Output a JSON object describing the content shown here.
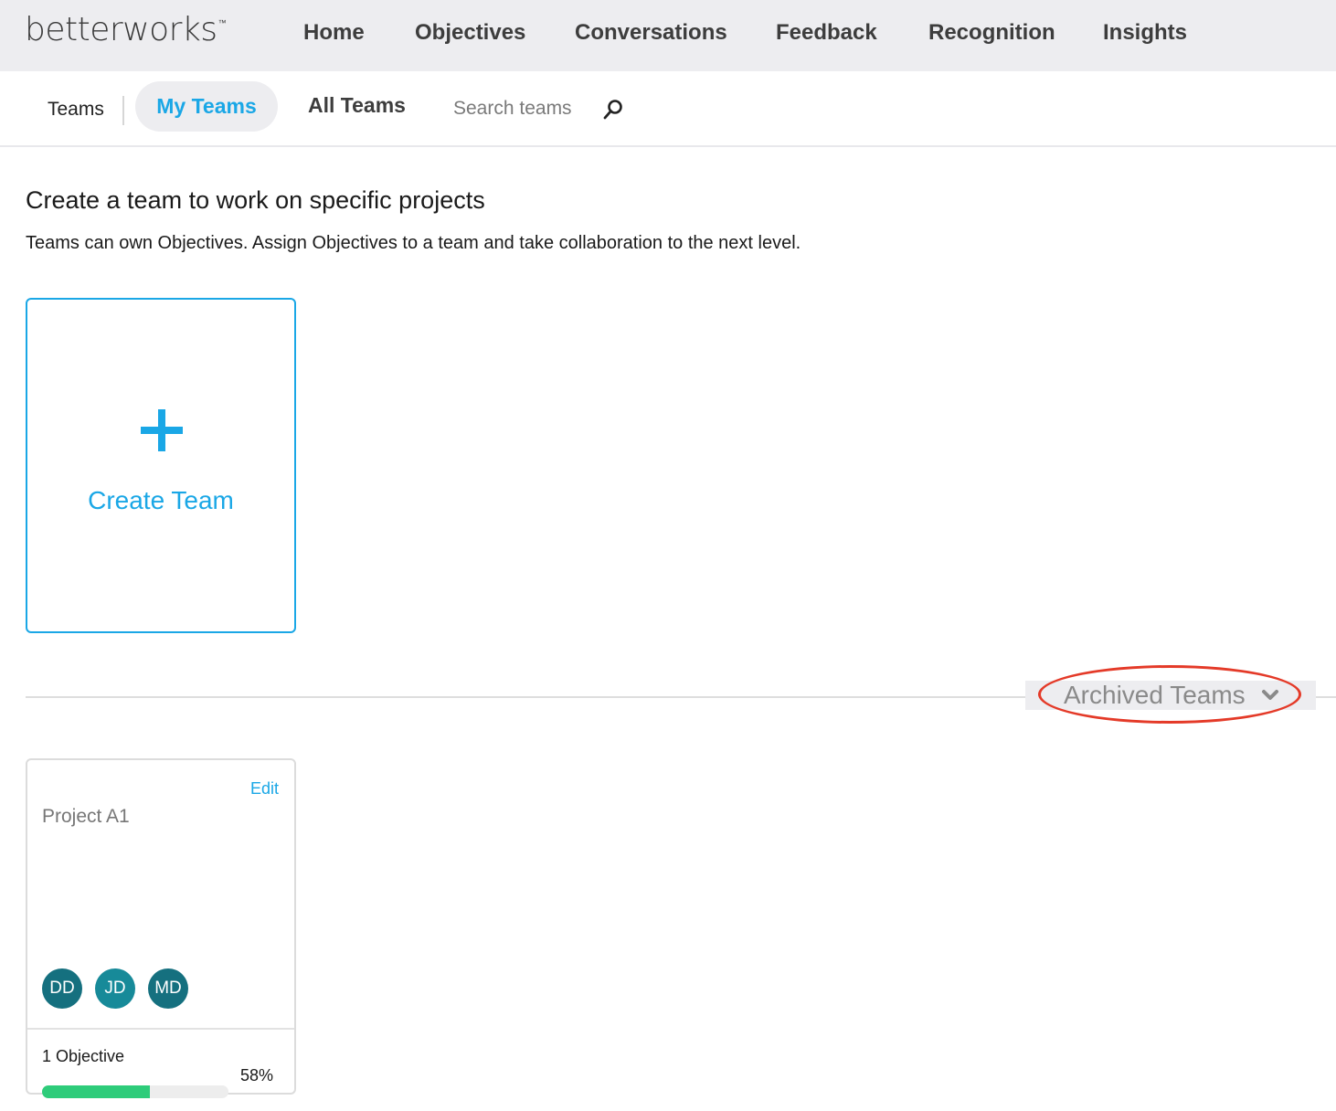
{
  "app": {
    "logo_text": "betterworks",
    "logo_mark": "™"
  },
  "topnav": {
    "items": [
      {
        "label": "Home"
      },
      {
        "label": "Objectives"
      },
      {
        "label": "Conversations"
      },
      {
        "label": "Feedback"
      },
      {
        "label": "Recognition"
      },
      {
        "label": "Insights"
      }
    ]
  },
  "subnav": {
    "section_label": "Teams",
    "tabs": [
      {
        "label": "My Teams",
        "active": true
      },
      {
        "label": "All Teams",
        "active": false
      }
    ],
    "search": {
      "placeholder": "Search teams",
      "value": ""
    },
    "search_icon": "search-icon"
  },
  "main": {
    "heading": "Create a team to work on specific projects",
    "description": "Teams can own Objectives. Assign Objectives to a team and take collaboration to the next level.",
    "create_card": {
      "label": "Create Team",
      "icon": "plus-icon"
    },
    "archived": {
      "label": "Archived Teams",
      "icon": "chevron-down-icon",
      "highlighted_color": "#e43a28"
    }
  },
  "teams": [
    {
      "name": "Project A1",
      "edit_label": "Edit",
      "members": [
        {
          "initials": "DD",
          "color": "#15707f"
        },
        {
          "initials": "JD",
          "color": "#178a99"
        },
        {
          "initials": "MD",
          "color": "#15707f"
        }
      ],
      "objectives_label": "1 Objective",
      "progress_label": "58%",
      "progress": 0.58
    }
  ],
  "colors": {
    "accent": "#1aa7e6",
    "nav_bg": "#ededf0",
    "progress": "#2ecc7a"
  }
}
